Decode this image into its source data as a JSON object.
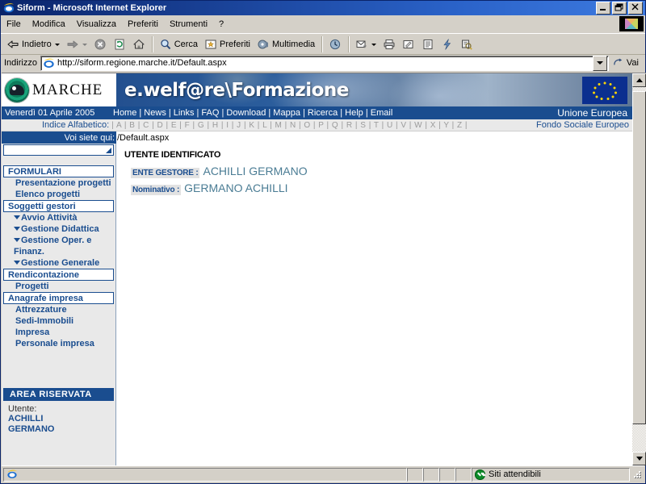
{
  "window": {
    "title": "Siform - Microsoft Internet Explorer",
    "icon": "ie-icon",
    "minimize_label": "_",
    "restore_label": "❐",
    "close_label": "✕"
  },
  "menubar": {
    "items": [
      {
        "label": "File"
      },
      {
        "label": "Modifica"
      },
      {
        "label": "Visualizza"
      },
      {
        "label": "Preferiti"
      },
      {
        "label": "Strumenti"
      },
      {
        "label": "?"
      }
    ],
    "logo_name": "windows-logo"
  },
  "toolbar": {
    "back_label": "Indietro",
    "back_icon": "back-arrow-icon",
    "forward_icon": "forward-arrow-icon",
    "stop_icon": "stop-icon",
    "refresh_icon": "refresh-icon",
    "home_icon": "home-icon",
    "search_label": "Cerca",
    "search_icon": "search-icon",
    "favorites_label": "Preferiti",
    "favorites_icon": "favorites-icon",
    "media_label": "Multimedia",
    "media_icon": "media-icon",
    "history_icon": "history-icon",
    "mail_icon": "mail-icon",
    "print_icon": "print-icon",
    "edit_icon": "edit-icon",
    "discuss_icon": "discuss-icon",
    "messenger_icon": "messenger-icon",
    "research_icon": "research-icon"
  },
  "address": {
    "label": "Indirizzo",
    "url": "http://siform.regione.marche.it/Default.aspx",
    "placeholder": "",
    "icon": "ie-page-icon",
    "dropdown_icon": "chevron-down-icon",
    "go_label": "Vai",
    "go_icon": "go-arrow-icon"
  },
  "page": {
    "banner": {
      "logo_word": "MARCHE",
      "logo_icon": "marche-emblem-icon",
      "title": "e.welf@re\\Formazione",
      "eu_flag_name": "eu-flag-icon"
    },
    "navbar": {
      "date": "Venerdì 01 Aprile 2005",
      "links": [
        "Home",
        "News",
        "Links",
        "FAQ",
        "Download",
        "Mappa",
        "Ricerca",
        "Help",
        "Email"
      ],
      "links_joined": "Home | News | Links | FAQ | Download | Mappa | Ricerca | Help | Email",
      "right_label": "Unione Europea"
    },
    "indexbar": {
      "label": "Indice Alfabetico:",
      "letters": "| A | B | C | D | E | F | G | H | I | J | K | L | M | N | O | P | Q | R | S | T | U | V | W | X | Y | Z |",
      "right_label": "Fondo Sociale Europeo"
    },
    "breadcrumb": {
      "label": "Voi siete qui:",
      "path": "/Default.aspx"
    },
    "sidebar": {
      "select_value": "",
      "select_icon": "dropdown-triangle-icon",
      "groups": [
        {
          "header": "FORMULARI",
          "items": [
            {
              "label": "Presentazione progetti",
              "arrow": false
            },
            {
              "label": "Elenco progetti",
              "arrow": false
            }
          ]
        },
        {
          "header": "Soggetti gestori",
          "items": [
            {
              "label": "Avvio Attività",
              "arrow": true
            },
            {
              "label": "Gestione Didattica",
              "arrow": true
            },
            {
              "label": "Gestione Oper. e Finanz.",
              "arrow": true
            },
            {
              "label": "Gestione Generale",
              "arrow": true
            }
          ]
        },
        {
          "header": "Rendicontazione",
          "items": [
            {
              "label": "Progetti",
              "arrow": false
            }
          ]
        },
        {
          "header": "Anagrafe impresa",
          "items": [
            {
              "label": "Attrezzature",
              "arrow": false
            },
            {
              "label": "Sedi-Immobili",
              "arrow": false
            },
            {
              "label": "Impresa",
              "arrow": false
            },
            {
              "label": "Personale impresa",
              "arrow": false
            }
          ]
        }
      ],
      "reserved_area": {
        "title": "AREA RISERVATA",
        "user_label": "Utente:",
        "user_line1": "ACHILLI",
        "user_line2": "GERMANO"
      }
    },
    "content": {
      "title": "UTENTE IDENTIFICATO",
      "rows": [
        {
          "key": "ENTE GESTORE :",
          "value": "ACHILLI GERMANO"
        },
        {
          "key": "Nominativo :",
          "value": "GERMANO ACHILLI"
        }
      ]
    },
    "scrollbar": {
      "up_icon": "scroll-up-icon",
      "down_icon": "scroll-down-icon",
      "thumb_name": "scroll-thumb"
    }
  },
  "statusbar": {
    "message": "",
    "zone_label": "Siti attendibili",
    "zone_icon": "trusted-sites-icon",
    "page_icon": "ie-status-icon"
  },
  "colors": {
    "brand_blue": "#1a4d8f",
    "title_bar": "#0a246a",
    "chrome": "#d4d0c8",
    "link_blue": "#1a4d8f",
    "value_teal": "#4a7c94",
    "zone_green": "#0a8a28"
  }
}
